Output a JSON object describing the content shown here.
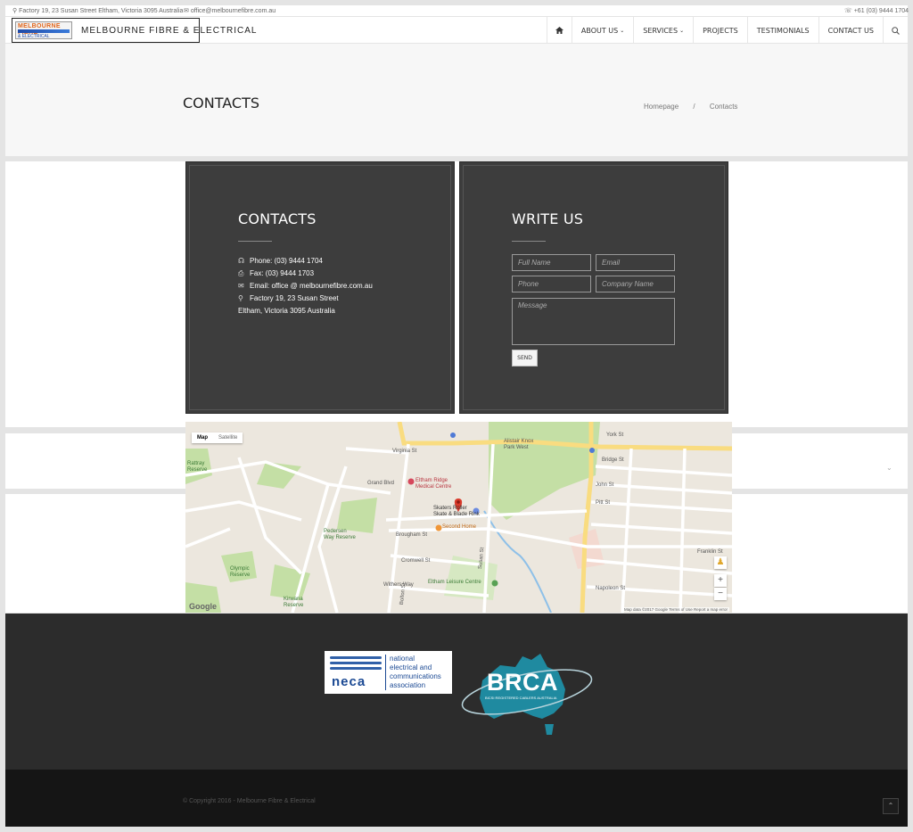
{
  "topbar": {
    "address": "Factory 19, 23 Susan Street Eltham, Victoria 3095 Australia",
    "email": "office@melbournefibre.com.au",
    "phone": "+61 (03) 9444 1704"
  },
  "header": {
    "logo_badge_line1": "MELBOURNE FIBRE",
    "logo_badge_line3": "& ELECTRICAL",
    "logo_text": "MELBOURNE FIBRE & ELECTRICAL",
    "nav": [
      {
        "label": "ABOUT US",
        "dropdown": true
      },
      {
        "label": "SERVICES",
        "dropdown": true
      },
      {
        "label": "PROJECTS",
        "dropdown": false
      },
      {
        "label": "TESTIMONIALS",
        "dropdown": false
      },
      {
        "label": "CONTACT US",
        "dropdown": false
      }
    ]
  },
  "title_band": {
    "title": "CONTACTS",
    "breadcrumb": [
      "Homepage",
      "/",
      "Contacts"
    ]
  },
  "contacts_panel": {
    "title": "CONTACTS",
    "phone": "Phone: (03) 9444 1704",
    "fax": "Fax: (03) 9444 1703",
    "email": "Email: office @ melbournefibre.com.au",
    "address_line1": "Factory 19, 23 Susan Street",
    "address_line2": "Eltham, Victoria 3095 Australia"
  },
  "write_panel": {
    "title": "WRITE US",
    "full_name_placeholder": "Full Name",
    "email_placeholder": "Email",
    "phone_placeholder": "Phone",
    "company_placeholder": "Company Name",
    "message_placeholder": "Message",
    "send_label": "SEND"
  },
  "map": {
    "toggle_map": "Map",
    "toggle_satellite": "Satellite",
    "labels": {
      "eltham_ridge": "Eltham Ridge\nMedical Centre",
      "skaters": "Skaters Roller\nSkate & Blade Rink",
      "second_home": "Second Home",
      "leisure": "Eltham Leisure Centre",
      "alistair": "Alistair Knox\nPark West",
      "grand_blvd": "Grand Blvd",
      "brougham": "Brougham St",
      "cromwell": "Cromwell St",
      "withers": "Withers Way",
      "john_st": "John St",
      "pitt_st": "Pitt St",
      "bridge_st": "Bridge St",
      "york_st": "York St",
      "napoleon": "Napoleon St",
      "franklin": "Franklin St",
      "pedersen": "Pedersen\nWay Reserve",
      "olympic": "Olympic\nReserve",
      "kirwana": "Kirwana\nReserve",
      "rattray": "Rattray\nReserve",
      "virginia": "Virginia St",
      "bolton": "Bolton St",
      "susan": "Susan St"
    },
    "footer": "Map data ©2017 Google    Terms of Use    Report a map error",
    "google": "Google"
  },
  "footer": {
    "neca_word": "neca",
    "neca_text": "national\nelectrical and\ncommunications\nassociation",
    "brca_word": "BRCA",
    "brca_sub": "BICSI REGISTERED CABLERS AUSTRALIA",
    "copyright": "© Copyright 2016 - Melbourne Fibre & Electrical"
  },
  "colors": {
    "panel_dark": "#3d3d3d",
    "footer_dark": "#2c2c2c",
    "brca_teal": "#1f8aa0",
    "neca_blue": "#1c4a94"
  }
}
